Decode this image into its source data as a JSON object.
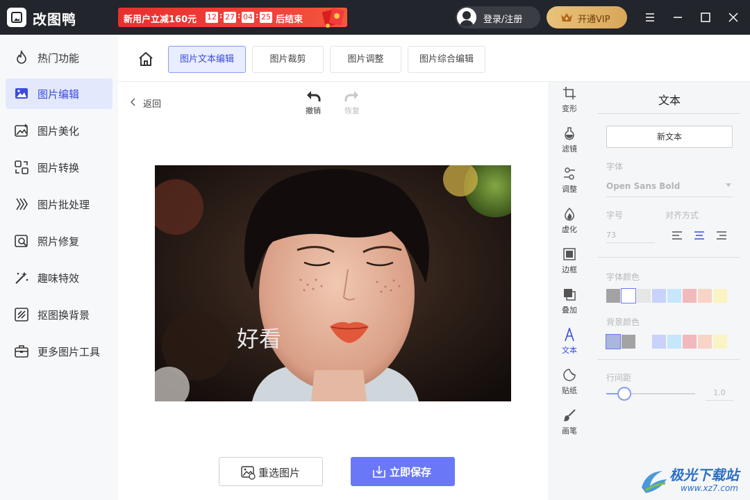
{
  "app": {
    "name": "改图鸭"
  },
  "promo": {
    "text": "新用户立减160元",
    "countdown": [
      "12",
      "27",
      "04",
      "25"
    ],
    "suffix": "后结束"
  },
  "header": {
    "login": "登录/注册",
    "vip": "开通VIP"
  },
  "sidebar": {
    "items": [
      {
        "label": "热门功能",
        "icon": "fire-icon"
      },
      {
        "label": "图片编辑",
        "icon": "image-edit-icon",
        "active": true
      },
      {
        "label": "图片美化",
        "icon": "image-beautify-icon"
      },
      {
        "label": "图片转换",
        "icon": "convert-icon"
      },
      {
        "label": "图片批处理",
        "icon": "batch-icon"
      },
      {
        "label": "照片修复",
        "icon": "photo-repair-icon"
      },
      {
        "label": "趣味特效",
        "icon": "magic-wand-icon"
      },
      {
        "label": "抠图换背景",
        "icon": "cutout-icon"
      },
      {
        "label": "更多图片工具",
        "icon": "toolbox-icon"
      }
    ]
  },
  "tabs": [
    {
      "label": "图片文本编辑",
      "active": true
    },
    {
      "label": "图片裁剪"
    },
    {
      "label": "图片调整"
    },
    {
      "label": "图片综合编辑"
    }
  ],
  "canvas": {
    "back": "返回",
    "undo": "撤销",
    "redo": "恢复",
    "overlay_text": "好看",
    "reselect": "重选图片",
    "save": "立即保存"
  },
  "tools": [
    {
      "label": "变形",
      "icon": "crop-icon"
    },
    {
      "label": "滤镜",
      "icon": "filter-icon"
    },
    {
      "label": "调整",
      "icon": "adjust-icon"
    },
    {
      "label": "虚化",
      "icon": "blur-icon"
    },
    {
      "label": "边框",
      "icon": "border-icon"
    },
    {
      "label": "叠加",
      "icon": "overlay-icon"
    },
    {
      "label": "文本",
      "icon": "text-icon",
      "active": true
    },
    {
      "label": "贴纸",
      "icon": "sticker-icon"
    },
    {
      "label": "画笔",
      "icon": "brush-icon"
    }
  ],
  "panel": {
    "title": "文本",
    "new_text": "新文本",
    "font_label": "字体",
    "font_value": "Open Sans Bold",
    "size_label": "字号",
    "size_value": "73",
    "align_label": "对齐方式",
    "font_color_label": "字体颜色",
    "font_colors": [
      "#a3a3a3",
      "#ffffff",
      "#e6e6e6",
      "#c8d2fb",
      "#c6e6fb",
      "#f2b9bc",
      "#f7d4c6",
      "#faf3c4"
    ],
    "bg_color_label": "背景颜色",
    "bg_colors": [
      "#a9b6e0",
      "#a3a3a3",
      "#f5f6f8",
      "#c8d2fb",
      "#c6e6fb",
      "#f2b9bc",
      "#f7d4c6",
      "#faf3c4"
    ],
    "line_spacing_label": "行间距",
    "line_spacing_value": "1.0",
    "line_spacing_level": 0.2
  },
  "watermark": {
    "title": "极光下载站",
    "url": "www.xz7.com"
  },
  "colors": {
    "accent": "#6a78f7",
    "active_text": "#3b4bdb",
    "titlebar": "#22252b"
  }
}
